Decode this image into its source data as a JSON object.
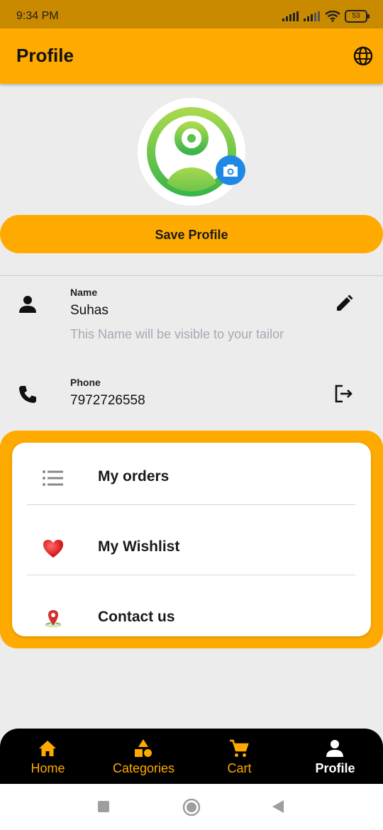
{
  "status_bar": {
    "time": "9:34 PM",
    "battery": "53"
  },
  "app_bar": {
    "title": "Profile",
    "action_icon": "globe-icon"
  },
  "avatar": {
    "icon": "user-avatar-icon",
    "edit_icon": "camera-icon"
  },
  "save_button": {
    "label": "Save Profile"
  },
  "name_field": {
    "label": "Name",
    "value": "Suhas",
    "hint": "This Name will be visible to your tailor",
    "icon": "person-icon",
    "action_icon": "edit-pencil-icon"
  },
  "phone_field": {
    "label": "Phone",
    "value": "7972726558",
    "icon": "phone-icon",
    "action_icon": "logout-icon"
  },
  "menu": {
    "items": [
      {
        "label": "My orders",
        "icon": "list-icon"
      },
      {
        "label": "My Wishlist",
        "icon": "heart-icon"
      },
      {
        "label": "Contact us",
        "icon": "location-pin-icon"
      }
    ]
  },
  "bottom_nav": {
    "items": [
      {
        "label": "Home",
        "icon": "home-icon"
      },
      {
        "label": "Categories",
        "icon": "shapes-icon"
      },
      {
        "label": "Cart",
        "icon": "cart-icon"
      },
      {
        "label": "Profile",
        "icon": "person-icon"
      }
    ],
    "active": "Profile"
  },
  "colors": {
    "accent": "#ffaa00",
    "status_bar": "#c98a00",
    "camera": "#1e88e5",
    "background": "#ececec"
  }
}
